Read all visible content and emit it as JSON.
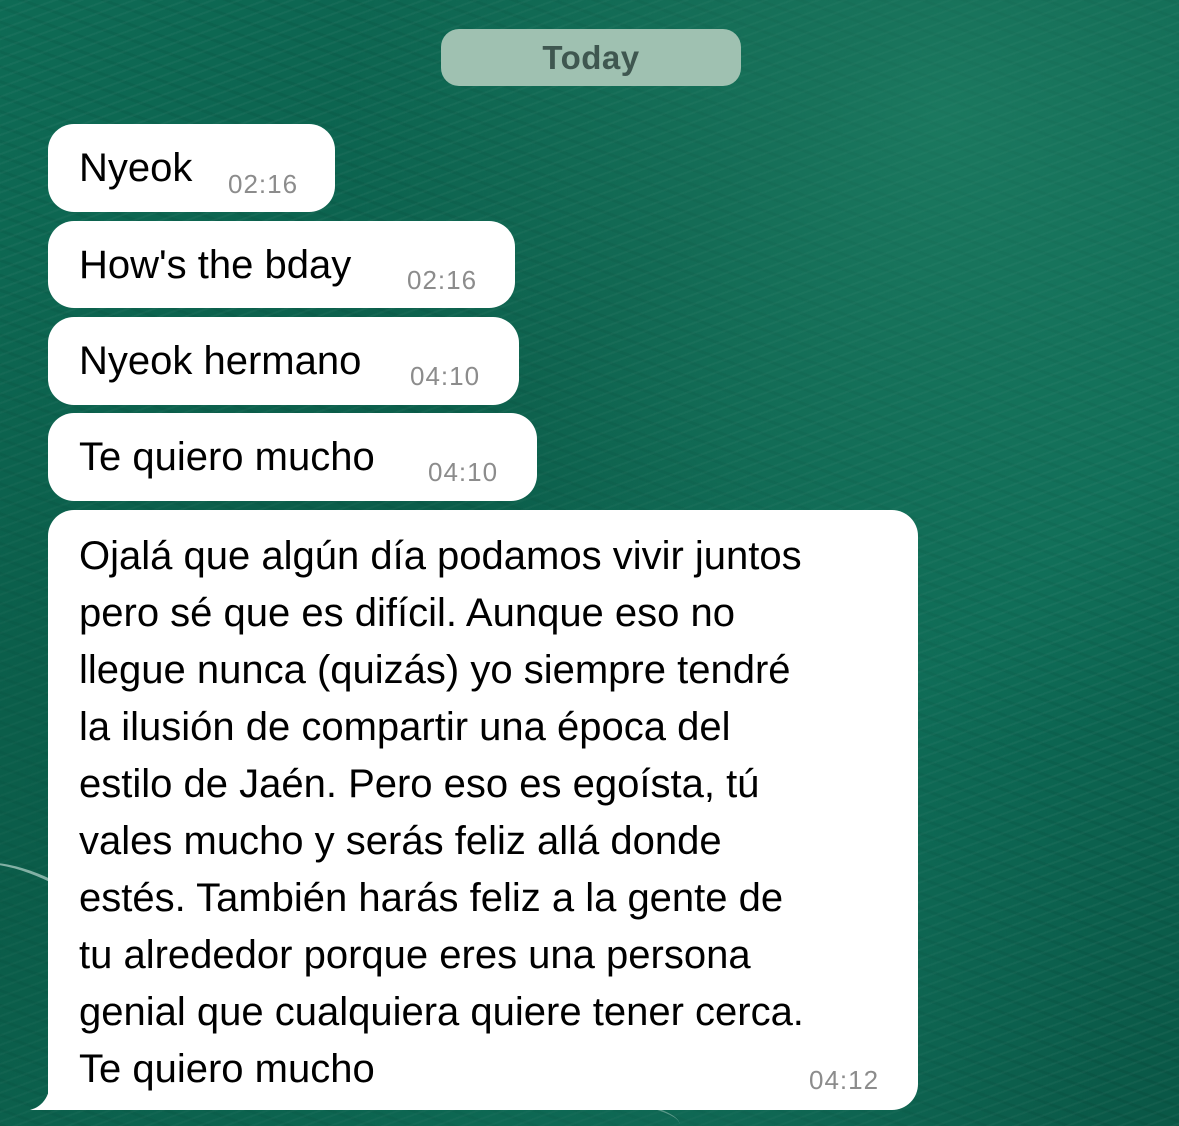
{
  "chat": {
    "date_separator": "Today",
    "messages": [
      {
        "text": "Nyeok",
        "time": "02:16"
      },
      {
        "text": "How's the bday",
        "time": "02:16"
      },
      {
        "text": "Nyeok hermano",
        "time": "04:10"
      },
      {
        "text": "Te quiero mucho",
        "time": "04:10"
      },
      {
        "lines": [
          "Ojalá que algún día podamos vivir juntos",
          "pero sé que es difícil. Aunque eso no",
          "llegue nunca (quizás) yo siempre tendré",
          "la ilusión de compartir una época del",
          "estilo de Jaén. Pero eso es egoísta, tú",
          "vales mucho y serás feliz allá donde",
          "estés. También harás feliz a la gente de",
          "tu alrededor porque eres una persona",
          "genial que cualquiera quiere tener cerca.",
          "Te quiero mucho"
        ],
        "time": "04:12"
      }
    ]
  },
  "colors": {
    "bubble_background": "#ffffff",
    "date_pill_background": "#9fc1b1",
    "timestamp": "#8c8c8c",
    "wallpaper": "#0b5e4b"
  }
}
